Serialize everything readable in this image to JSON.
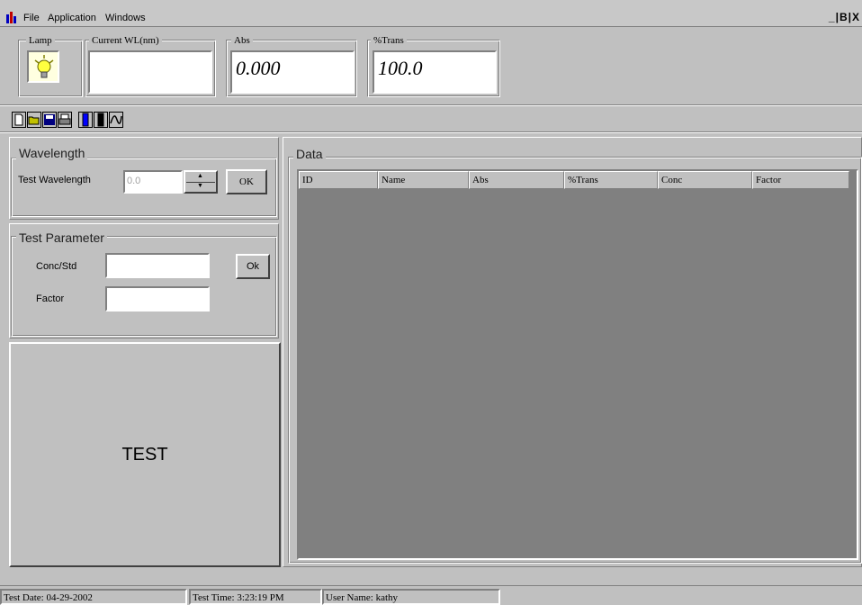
{
  "menu": {
    "items": [
      "File",
      "Application",
      "Windows"
    ],
    "window_controls": "_|B|X"
  },
  "readouts": {
    "lamp_label": "Lamp",
    "current_wl_label": "Current WL(nm)",
    "current_wl_value": "",
    "abs_label": "Abs",
    "abs_value": "0.000",
    "trans_label": "%Trans",
    "trans_value": "100.0"
  },
  "toolbar": {
    "icons": [
      "new-file-icon",
      "open-folder-icon",
      "save-icon",
      "print-icon",
      "blue-cuvette-icon",
      "black-cuvette-icon",
      "wavelength-scan-icon"
    ]
  },
  "wavelength": {
    "title": "Wavelength",
    "test_label": "Test Wavelength",
    "test_value": "0.0",
    "ok_label": "OK"
  },
  "parameter": {
    "title": "Test Parameter",
    "conc_label": "Conc/Std",
    "conc_value": "",
    "factor_label": "Factor",
    "factor_value": "",
    "ok_label": "Ok"
  },
  "test_button": "TEST",
  "data_panel": {
    "title": "Data",
    "columns": [
      "ID",
      "Name",
      "Abs",
      "%Trans",
      "Conc",
      "Factor"
    ],
    "rows": []
  },
  "status": {
    "test_date": "Test Date:  04-29-2002",
    "test_time": "Test Time: 3:23:19 PM",
    "user_name": "User Name: kathy"
  },
  "colors": {
    "face": "#c0c0c0",
    "grid_bg": "#808080",
    "lamp_bg": "#ffffe0"
  }
}
